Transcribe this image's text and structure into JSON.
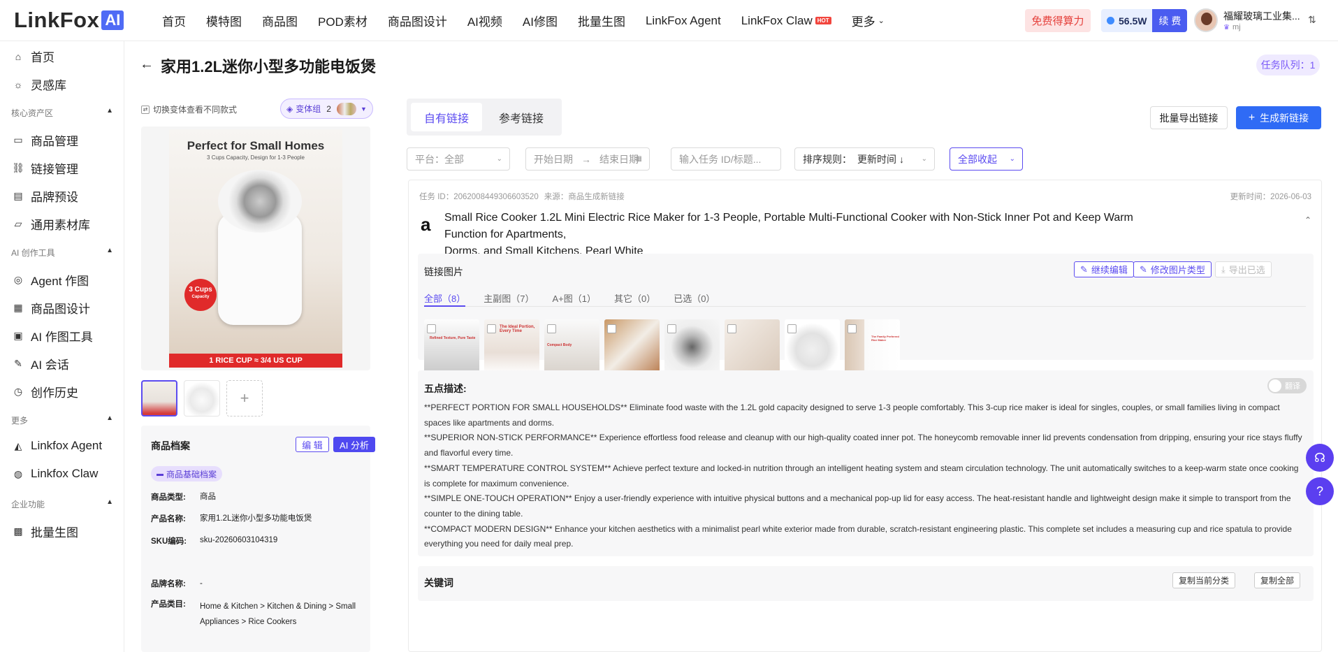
{
  "brand": {
    "name": "LinkFox",
    "ai_badge": "AI"
  },
  "nav": [
    {
      "label": "首页"
    },
    {
      "label": "模特图"
    },
    {
      "label": "商品图"
    },
    {
      "label": "POD素材"
    },
    {
      "label": "商品图设计"
    },
    {
      "label": "AI视频"
    },
    {
      "label": "AI修图"
    },
    {
      "label": "批量生图"
    },
    {
      "label": "LinkFox Agent"
    },
    {
      "label": "LinkFox Claw",
      "badge": "HOT"
    },
    {
      "label": "更多"
    }
  ],
  "header": {
    "free_credit": "免费得算力",
    "credit_amount": "56.5W",
    "renew": "续 费",
    "user_name": "福耀玻璃工业集...",
    "user_id": "mj"
  },
  "sidebar": {
    "top": [
      {
        "label": "首页",
        "icon": "home-icon"
      },
      {
        "label": "灵感库",
        "icon": "bulb-icon"
      }
    ],
    "sections": [
      {
        "title": "核心资产区",
        "items": [
          {
            "label": "商品管理",
            "icon": "box-icon"
          },
          {
            "label": "链接管理",
            "icon": "link-icon"
          },
          {
            "label": "品牌预设",
            "icon": "brand-icon"
          },
          {
            "label": "通用素材库",
            "icon": "folder-icon"
          }
        ]
      },
      {
        "title": "AI 创作工具",
        "items": [
          {
            "label": "Agent 作图",
            "icon": "agent-icon"
          },
          {
            "label": "商品图设计",
            "icon": "layout-icon"
          },
          {
            "label": "AI 作图工具",
            "icon": "image-icon"
          },
          {
            "label": "AI 会话",
            "icon": "chat-icon"
          },
          {
            "label": "创作历史",
            "icon": "history-icon"
          }
        ]
      },
      {
        "title": "更多",
        "items": [
          {
            "label": "Linkfox Agent",
            "icon": "triangle-icon"
          },
          {
            "label": "Linkfox Claw",
            "icon": "claw-icon"
          }
        ]
      },
      {
        "title": "企业功能",
        "items": [
          {
            "label": "批量生图",
            "icon": "batch-icon"
          }
        ]
      }
    ]
  },
  "page": {
    "title": "家用1.2L迷你小型多功能电饭煲",
    "queue": "任务队列：1"
  },
  "left_panel": {
    "switch_note": "切换变体查看不同款式",
    "variant_group": "变体组",
    "variant_count": "2",
    "product_image": {
      "headline": "Perfect for Small Homes",
      "sub": "3 Cups Capacity, Design for 1-3 People",
      "badge_line1": "3 Cups",
      "badge_line2": "Capacity",
      "bottom_bar": "1 RICE CUP ≈ 3/4 US CUP"
    },
    "archive": {
      "title": "商品档案",
      "edit": "编 辑",
      "ai_analyze": "AI 分析",
      "tag": "商品基础档案",
      "rows": [
        {
          "k": "商品类型:",
          "v": "商品"
        },
        {
          "k": "产品名称:",
          "v": "家用1.2L迷你小型多功能电饭煲"
        },
        {
          "k": "SKU编码:",
          "v": "sku-20260603104319"
        },
        {
          "k": "品牌名称:",
          "v": "-"
        },
        {
          "k": "产品类目:",
          "v": "Home & Kitchen > Kitchen & Dining > Small Appliances > Rice Cookers"
        }
      ]
    }
  },
  "right_panel": {
    "tabs": [
      {
        "label": "自有链接"
      },
      {
        "label": "参考链接"
      }
    ],
    "export_links": "批量导出链接",
    "generate_link": "生成新链接",
    "filters": {
      "platform": "平台：全部",
      "start_date": "开始日期",
      "end_date": "结束日期",
      "search_placeholder": "输入任务 ID/标题...",
      "sort_label": "排序规则：",
      "sort_value": "更新时间",
      "collapse": "全部收起"
    },
    "card": {
      "task_id": "任务 ID：2062008449306603520",
      "source": "来源：商品生成新链接",
      "updated": "更新时间：2026-06-03",
      "title_line1": "Small Rice Cooker 1.2L Mini Electric Rice Maker for 1-3 People, Portable Multi-Functional Cooker with Non-Stick Inner Pot and Keep Warm Function for Apartments,",
      "title_line2": "Dorms, and Small Kitchens, Pearl White",
      "images_label": "链接图片",
      "continue_edit": "继续编辑",
      "modify_type": "修改图片类型",
      "export_selected": "导出已选",
      "image_tabs": [
        {
          "label": "全部（8）"
        },
        {
          "label": "主副图（7）"
        },
        {
          "label": "A+图（1）"
        },
        {
          "label": "其它（0）"
        },
        {
          "label": "已选（0）"
        }
      ],
      "thumb_texts": [
        "Refined Texture, Pure Taste",
        "The Ideal Portion, Every Time",
        "Compact Body",
        "",
        "",
        "",
        "",
        "The Family Preferred Rice Maker"
      ],
      "five_points_label": "五点描述:",
      "translate": "翻译",
      "bullets": [
        "**PERFECT PORTION FOR SMALL HOUSEHOLDS** Eliminate food waste with the 1.2L gold capacity designed to serve 1-3 people comfortably. This 3-cup rice maker is ideal for singles, couples, or small families living in compact spaces like apartments and dorms.",
        "**SUPERIOR NON-STICK PERFORMANCE** Experience effortless food release and cleanup with our high-quality coated inner pot. The honeycomb removable inner lid prevents condensation from dripping, ensuring your rice stays fluffy and flavorful every time.",
        "**SMART TEMPERATURE CONTROL SYSTEM** Achieve perfect texture and locked-in nutrition through an intelligent heating system and steam circulation technology. The unit automatically switches to a keep-warm state once cooking is complete for maximum convenience.",
        "**SIMPLE ONE-TOUCH OPERATION** Enjoy a user-friendly experience with intuitive physical buttons and a mechanical pop-up lid for easy access. The heat-resistant handle and lightweight design make it simple to transport from the counter to the dining table.",
        "**COMPACT MODERN DESIGN** Enhance your kitchen aesthetics with a minimalist pearl white exterior made from durable, scratch-resistant engineering plastic. This complete set includes a measuring cup and rice spatula to provide everything you need for daily meal prep."
      ],
      "keywords_label": "关键词",
      "copy_category": "复制当前分类",
      "copy_all": "复制全部"
    }
  },
  "colors": {
    "accent": "#5b4bf0",
    "primary_blue": "#2f6bf5",
    "brand_blue": "#4f6bf5"
  }
}
